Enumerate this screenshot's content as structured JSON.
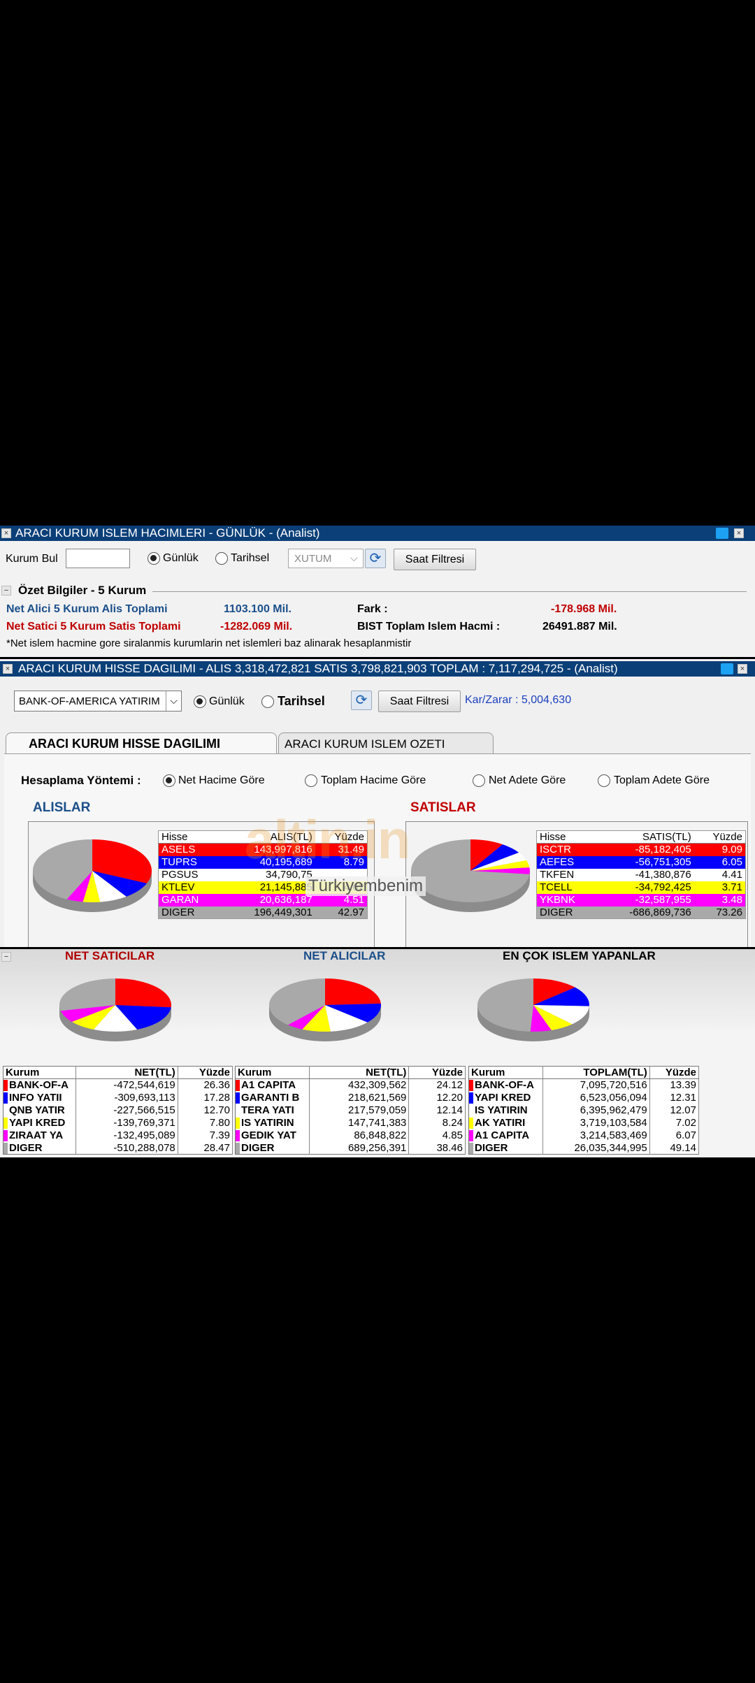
{
  "colors": {
    "red": "#ff0000",
    "blue": "#0000ff",
    "white": "#ffffff",
    "yellow": "#ffff00",
    "magenta": "#ff00ff",
    "gray": "#a9a9a9",
    "title": "#0b3f78"
  },
  "panel1": {
    "title": "ARACI KURUM ISLEM HACIMLERI - GÜNLÜK - (Analist)",
    "kurum_bul_label": "Kurum Bul",
    "kurum_bul_value": "",
    "radio_gunluk": "Günlük",
    "radio_tarihsel": "Tarihsel",
    "select_value": "XUTUM",
    "saat_filtresi": "Saat Filtresi",
    "section_title": "Özet Bilgiler - 5 Kurum",
    "net_alici_label": "Net Alici 5 Kurum Alis Toplami",
    "net_alici_value": "1103.100 Mil.",
    "net_satici_label": "Net Satici 5 Kurum Satis Toplami",
    "net_satici_value": "-1282.069 Mil.",
    "fark_label": "Fark :",
    "fark_value": "-178.968 Mil.",
    "bist_label": "BIST Toplam Islem Hacmi :",
    "bist_value": "26491.887 Mil.",
    "note": "*Net islem hacmine gore siralanmis kurumlarin net islemleri baz alinarak hesaplanmistir"
  },
  "panel2": {
    "title": "ARACI KURUM HISSE DAGILIMI - ALIS 3,318,472,821  SATIS 3,798,821,903  TOPLAM : 7,117,294,725 - (Analist)",
    "kurum_select": "BANK-OF-AMERICA YATIRIM",
    "radio_gunluk": "Günlük",
    "radio_tarihsel": "Tarihsel",
    "saat_filtresi": "Saat Filtresi",
    "kar_zarar": "Kar/Zarar : 5,004,630",
    "tab_active": "ARACI KURUM HISSE DAGILIMI",
    "tab_inactive": "ARACI KURUM ISLEM OZETI",
    "hesaplama_label": "Hesaplama Yöntemi :",
    "methods": [
      "Net Hacime Göre",
      "Toplam Hacime Göre",
      "Net Adete Göre",
      "Toplam Adete Göre"
    ],
    "alislar_label": "ALISLAR",
    "satislar_label": "SATISLAR",
    "watermark": "altin.in",
    "watermark2": "Türkiyembenim"
  },
  "alis_table": {
    "headers": [
      "Hisse",
      "ALIS(TL)",
      "Yüzde"
    ],
    "rows": [
      {
        "hisse": "ASELS",
        "tl": "143,997,816",
        "pct": "31.49",
        "color": "red"
      },
      {
        "hisse": "TUPRS",
        "tl": "40,195,689",
        "pct": "8.79",
        "color": "blue"
      },
      {
        "hisse": "PGSUS",
        "tl": "34,790,75",
        "pct": "",
        "color": "white"
      },
      {
        "hisse": "KTLEV",
        "tl": "21,145,885",
        "pct": "4.62",
        "color": "yellow"
      },
      {
        "hisse": "GARAN",
        "tl": "20,636,187",
        "pct": "4.51",
        "color": "magenta"
      },
      {
        "hisse": "DIGER",
        "tl": "196,449,301",
        "pct": "42.97",
        "color": "gray"
      }
    ]
  },
  "satis_table": {
    "headers": [
      "Hisse",
      "SATIS(TL)",
      "Yüzde"
    ],
    "rows": [
      {
        "hisse": "ISCTR",
        "tl": "-85,182,405",
        "pct": "9.09",
        "color": "red"
      },
      {
        "hisse": "AEFES",
        "tl": "-56,751,305",
        "pct": "6.05",
        "color": "blue"
      },
      {
        "hisse": "TKFEN",
        "tl": "-41,380,876",
        "pct": "4.41",
        "color": "white"
      },
      {
        "hisse": "TCELL",
        "tl": "-34,792,425",
        "pct": "3.71",
        "color": "yellow"
      },
      {
        "hisse": "YKBNK",
        "tl": "-32,587,955",
        "pct": "3.48",
        "color": "magenta"
      },
      {
        "hisse": "DIGER",
        "tl": "-686,869,736",
        "pct": "73.26",
        "color": "gray"
      }
    ]
  },
  "panel3": {
    "net_saticilar": "NET SATICILAR",
    "net_alicilar": "NET ALICILAR",
    "en_cok": "EN ÇOK ISLEM YAPANLAR"
  },
  "net_satici_table": {
    "headers": [
      "Kurum",
      "NET(TL)",
      "Yüzde"
    ],
    "rows": [
      {
        "k": "BANK-OF-A",
        "tl": "-472,544,619",
        "pct": "26.36",
        "color": "red"
      },
      {
        "k": "INFO YATII",
        "tl": "-309,693,113",
        "pct": "17.28",
        "color": "blue"
      },
      {
        "k": "QNB YATIR",
        "tl": "-227,566,515",
        "pct": "12.70",
        "color": "white"
      },
      {
        "k": "YAPI KRED",
        "tl": "-139,769,371",
        "pct": "7.80",
        "color": "yellow"
      },
      {
        "k": "ZIRAAT YA",
        "tl": "-132,495,089",
        "pct": "7.39",
        "color": "magenta"
      },
      {
        "k": "DIGER",
        "tl": "-510,288,078",
        "pct": "28.47",
        "color": "gray"
      }
    ]
  },
  "net_alici_table": {
    "headers": [
      "Kurum",
      "NET(TL)",
      "Yüzde"
    ],
    "rows": [
      {
        "k": "A1 CAPITA",
        "tl": "432,309,562",
        "pct": "24.12",
        "color": "red"
      },
      {
        "k": "GARANTI B",
        "tl": "218,621,569",
        "pct": "12.20",
        "color": "blue"
      },
      {
        "k": "TERA YATI",
        "tl": "217,579,059",
        "pct": "12.14",
        "color": "white"
      },
      {
        "k": "IS YATIRIN",
        "tl": "147,741,383",
        "pct": "8.24",
        "color": "yellow"
      },
      {
        "k": "GEDIK YAT",
        "tl": "86,848,822",
        "pct": "4.85",
        "color": "magenta"
      },
      {
        "k": "DIGER",
        "tl": "689,256,391",
        "pct": "38.46",
        "color": "gray"
      }
    ]
  },
  "en_cok_table": {
    "headers": [
      "Kurum",
      "TOPLAM(TL)",
      "Yüzde"
    ],
    "rows": [
      {
        "k": "BANK-OF-A",
        "tl": "7,095,720,516",
        "pct": "13.39",
        "color": "red"
      },
      {
        "k": "YAPI KRED",
        "tl": "6,523,056,094",
        "pct": "12.31",
        "color": "blue"
      },
      {
        "k": "IS YATIRIN",
        "tl": "6,395,962,479",
        "pct": "12.07",
        "color": "white"
      },
      {
        "k": "AK YATIRI",
        "tl": "3,719,103,584",
        "pct": "7.02",
        "color": "yellow"
      },
      {
        "k": "A1 CAPITA",
        "tl": "3,214,583,469",
        "pct": "6.07",
        "color": "magenta"
      },
      {
        "k": "DIGER",
        "tl": "26,035,344,995",
        "pct": "49.14",
        "color": "gray"
      }
    ]
  }
}
